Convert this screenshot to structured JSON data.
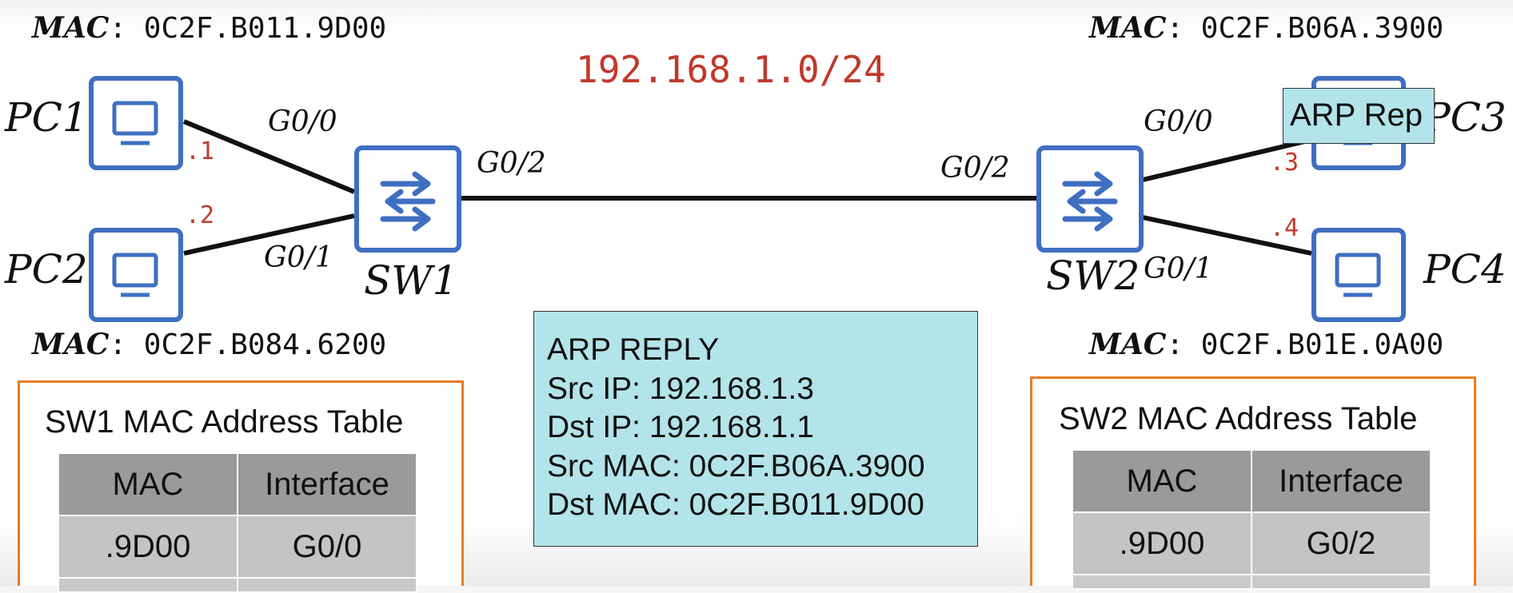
{
  "subnet": "192.168.1.0/24",
  "pcs": {
    "pc1": {
      "name": "PC1",
      "mac_key": "MAC",
      "mac_value": ": 0C2F.B011.9D00",
      "ip_suffix": ".1"
    },
    "pc2": {
      "name": "PC2",
      "mac_key": "MAC",
      "mac_value": ": 0C2F.B084.6200",
      "ip_suffix": ".2"
    },
    "pc3": {
      "name": "PC3",
      "mac_key": "MAC",
      "mac_value": ": 0C2F.B06A.3900",
      "ip_suffix": ".3"
    },
    "pc4": {
      "name": "PC4",
      "mac_key": "MAC",
      "mac_value": ": 0C2F.B01E.0A00",
      "ip_suffix": ".4"
    }
  },
  "switches": {
    "sw1": {
      "name": "SW1",
      "ports": {
        "g00": "G0/0",
        "g01": "G0/1",
        "g02": "G0/2"
      }
    },
    "sw2": {
      "name": "SW2",
      "ports": {
        "g00": "G0/0",
        "g01": "G0/1",
        "g02": "G0/2"
      }
    }
  },
  "arp_reply": {
    "title": "ARP REPLY",
    "src_ip": "Src IP: 192.168.1.3",
    "dst_ip": "Dst IP: 192.168.1.1",
    "src_mac": "Src MAC: 0C2F.B06A.3900",
    "dst_mac": "Dst MAC: 0C2F.B011.9D00"
  },
  "arp_tag": "ARP Rep",
  "sw1_table": {
    "title": "SW1 MAC Address Table",
    "headers": [
      "MAC",
      "Interface"
    ],
    "rows": [
      [
        ".9D00",
        "G0/0"
      ]
    ]
  },
  "sw2_table": {
    "title": "SW2 MAC Address Table",
    "headers": [
      "MAC",
      "Interface"
    ],
    "rows": [
      [
        ".9D00",
        "G0/2"
      ]
    ]
  },
  "colors": {
    "device_blue": "#3f6fc2",
    "ip_red": "#c0392b",
    "table_border": "#e67e22",
    "arp_box": "#b3e4ea"
  }
}
